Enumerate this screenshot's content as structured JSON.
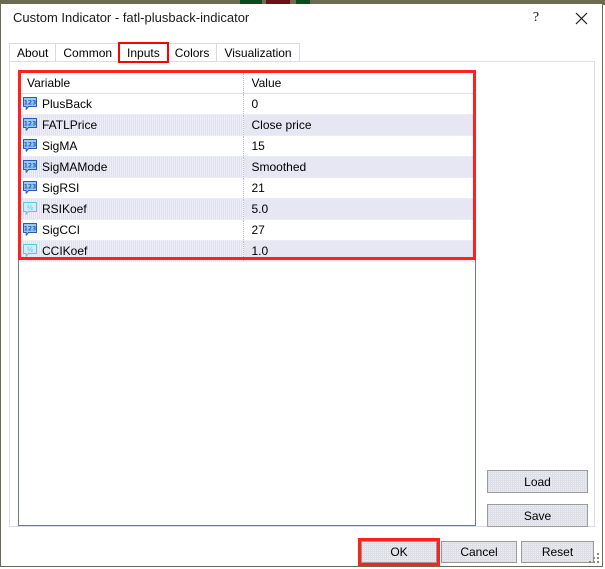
{
  "window": {
    "title": "Custom Indicator - fatl-plusback-indicator",
    "help_label": "?",
    "close_label": "Close",
    "help_icon": "question-mark-icon",
    "close_icon": "close-x-icon"
  },
  "tabs": [
    {
      "label": "About",
      "active": false,
      "highlighted": false
    },
    {
      "label": "Common",
      "active": false,
      "highlighted": false
    },
    {
      "label": "Inputs",
      "active": true,
      "highlighted": true
    },
    {
      "label": "Colors",
      "active": false,
      "highlighted": false
    },
    {
      "label": "Visualization",
      "active": false,
      "highlighted": false
    }
  ],
  "table": {
    "headers": {
      "variable": "Variable",
      "value": "Value"
    },
    "rows": [
      {
        "icon": "integer-type-icon",
        "icon_glyph": "123",
        "variable": "PlusBack",
        "value": "0"
      },
      {
        "icon": "integer-type-icon",
        "icon_glyph": "123",
        "variable": "FATLPrice",
        "value": "Close price"
      },
      {
        "icon": "integer-type-icon",
        "icon_glyph": "123",
        "variable": "SigMA",
        "value": "15"
      },
      {
        "icon": "integer-type-icon",
        "icon_glyph": "123",
        "variable": "SigMAMode",
        "value": "Smoothed"
      },
      {
        "icon": "integer-type-icon",
        "icon_glyph": "123",
        "variable": "SigRSI",
        "value": "21"
      },
      {
        "icon": "float-type-icon",
        "icon_glyph": "1/2",
        "variable": "RSIKoef",
        "value": "5.0"
      },
      {
        "icon": "integer-type-icon",
        "icon_glyph": "123",
        "variable": "SigCCI",
        "value": "27"
      },
      {
        "icon": "float-type-icon",
        "icon_glyph": "1/2",
        "variable": "CCIKoef",
        "value": "1.0"
      }
    ]
  },
  "buttons": {
    "load": "Load",
    "save": "Save",
    "ok": "OK",
    "cancel": "Cancel",
    "reset": "Reset"
  },
  "colors": {
    "highlight": "#ff2020",
    "integer_icon": "#1e5fbe",
    "float_icon": "#57c7e8",
    "window_border": "#6b6b52",
    "row_stripe": "#dfdff0"
  }
}
